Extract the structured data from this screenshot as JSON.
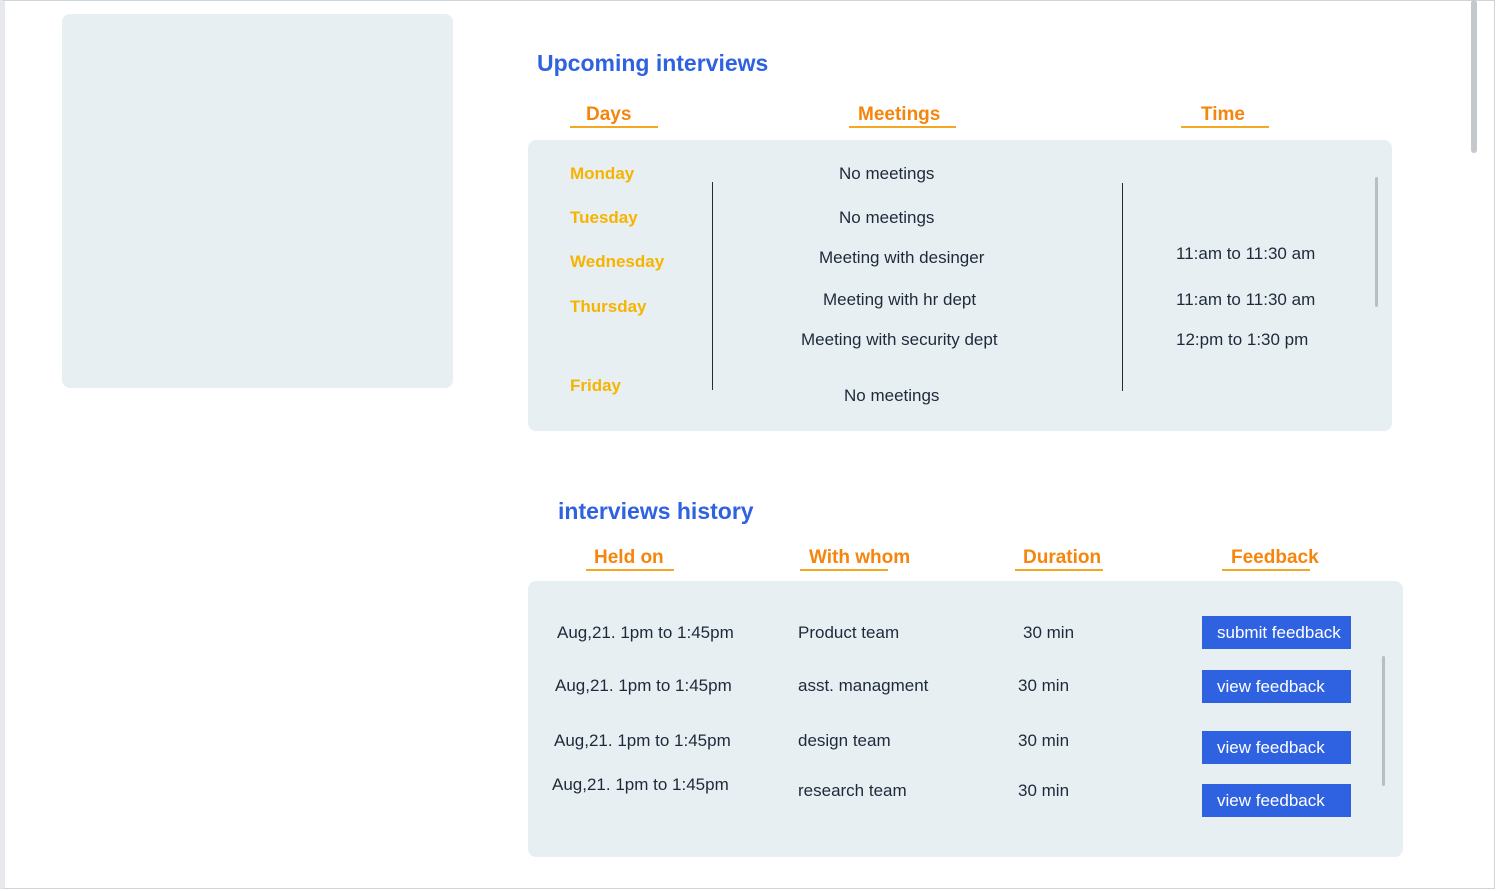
{
  "upcoming": {
    "title": "Upcoming interviews",
    "headers": {
      "days": "Days",
      "meetings": "Meetings",
      "time": "Time"
    },
    "days": [
      "Monday",
      "Tuesday",
      "Wednesday",
      "Thursday",
      "Friday"
    ],
    "meetings": [
      "No meetings",
      "No meetings",
      "Meeting with desinger",
      "Meeting with hr dept",
      "Meeting with security dept",
      "No meetings"
    ],
    "times": [
      "11:am to 11:30 am",
      "11:am to 11:30 am",
      "12:pm to 1:30 pm"
    ]
  },
  "history": {
    "title": "interviews history",
    "headers": {
      "held_on": "Held on",
      "with_whom": "With whom",
      "duration": "Duration",
      "feedback": "Feedback"
    },
    "rows": [
      {
        "held_on": "Aug,21. 1pm to 1:45pm",
        "with_whom": "Product team",
        "duration": "30 min",
        "action": "submit  feedback"
      },
      {
        "held_on": "Aug,21. 1pm to 1:45pm",
        "with_whom": "asst. managment",
        "duration": "30 min",
        "action": "view feedback"
      },
      {
        "held_on": "Aug,21. 1pm to 1:45pm",
        "with_whom": "design team",
        "duration": "30 min",
        "action": "view feedback"
      },
      {
        "held_on": "Aug,21. 1pm to 1:45pm",
        "with_whom": "research team",
        "duration": "30 min",
        "action": "view feedback"
      }
    ]
  },
  "colors": {
    "accent": "#2f62e0",
    "header_orange": "#f5850c",
    "day_yellow": "#f6b400",
    "panel_bg": "#e8eff3"
  }
}
